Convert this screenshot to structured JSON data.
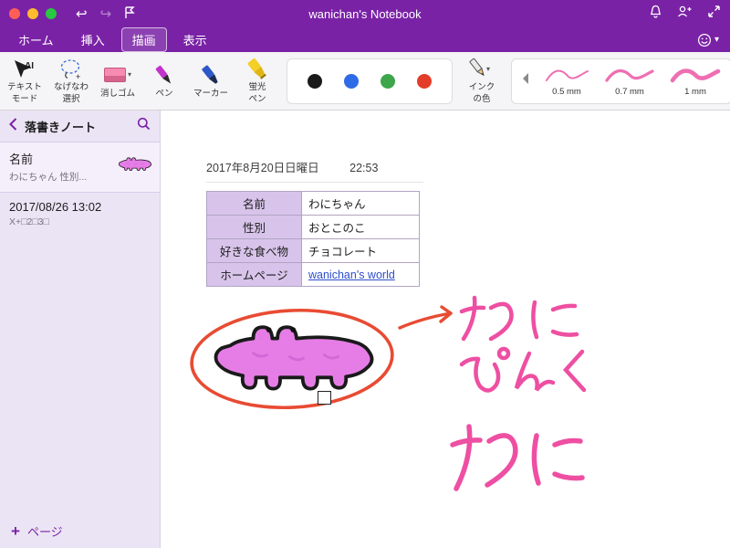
{
  "titlebar": {
    "title": "wanichan's Notebook",
    "undo_glyph": "↩",
    "redo_glyph": "↪"
  },
  "tabs": [
    {
      "label": "ホーム"
    },
    {
      "label": "挿入"
    },
    {
      "label": "描画"
    },
    {
      "label": "表示"
    }
  ],
  "ribbon": {
    "text_mode_l1": "テキスト",
    "text_mode_l2": "モード",
    "lasso_l1": "なげなわ",
    "lasso_l2": "選択",
    "eraser": "消しゴム",
    "pen": "ペン",
    "marker": "マーカー",
    "highlighter_l1": "蛍光",
    "highlighter_l2": "ペン",
    "ink_l1": "インク",
    "ink_l2": "の色",
    "dropdown_glyph": "▾",
    "colors": [
      {
        "name": "black",
        "hex": "#1a1a1a"
      },
      {
        "name": "blue",
        "hex": "#2e6be6"
      },
      {
        "name": "green",
        "hex": "#3da64b"
      },
      {
        "name": "red",
        "hex": "#e33d2a"
      }
    ],
    "widths": [
      {
        "label": "0.5 mm"
      },
      {
        "label": "0.7 mm"
      },
      {
        "label": "1 mm"
      }
    ]
  },
  "sidebar": {
    "notebook_title": "落書きノート",
    "pages": [
      {
        "title": "名前",
        "subtitle": "わにちゃん 性別..."
      },
      {
        "title": "2017/08/26 13:02",
        "subtitle": "X+□2□3□"
      }
    ],
    "add_page_label": "ページ",
    "plus_glyph": "+"
  },
  "canvas": {
    "date": "2017年8月20日日曜日",
    "time": "22:53",
    "table": {
      "rows": [
        {
          "label": "名前",
          "value": "わにちゃん",
          "link": false
        },
        {
          "label": "性別",
          "value": "おとこのこ",
          "link": false
        },
        {
          "label": "好きな食べ物",
          "value": "チョコレート",
          "link": false
        },
        {
          "label": "ホームページ",
          "value": "wanichan's world",
          "link": true
        }
      ]
    },
    "handwriting": {
      "word1": "わに",
      "word2": "ぴんく",
      "word3": "わに"
    },
    "drawing_desc": "ピンクのわにの絵"
  },
  "colors": {
    "brand_purple": "#7a22a6",
    "traffic_red": "#ff5f57",
    "traffic_yellow": "#febc2e",
    "traffic_green": "#28c840",
    "ink_pink": "#ee4fa2",
    "annotation_red": "#e84b33",
    "croc_pink": "#e67de6",
    "link_blue": "#2d4ecd"
  }
}
